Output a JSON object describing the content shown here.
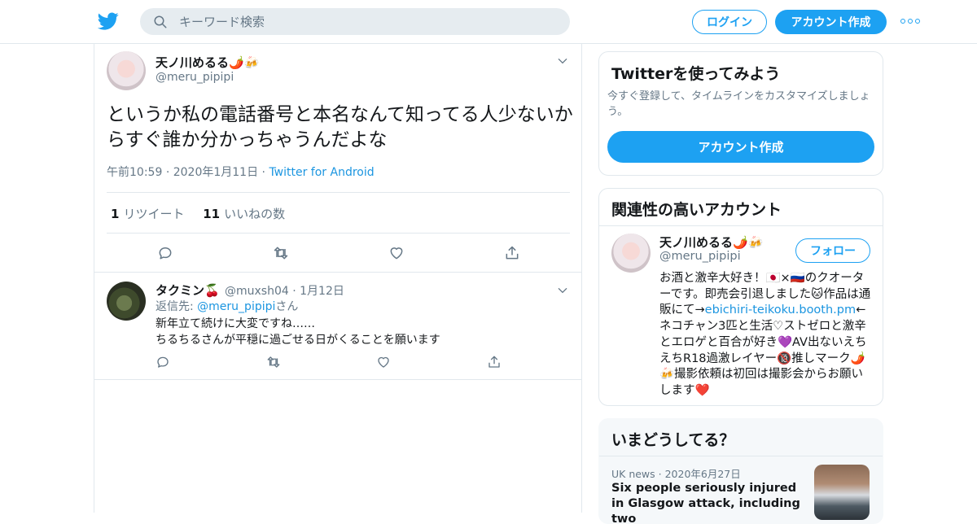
{
  "header": {
    "search_placeholder": "キーワード検索",
    "login_label": "ログイン",
    "signup_label": "アカウント作成"
  },
  "tweet": {
    "display_name": "天ノ川めるる🌶️🍻",
    "handle": "@meru_pipipi",
    "text": "というか私の電話番号と本名なんて知ってる人少ないからすぐ誰か分かっちゃうんだよな",
    "time": "午前10:59",
    "date": "2020年1月11日",
    "source": "Twitter for Android",
    "retweet_count": "1",
    "retweet_label": "リツイート",
    "like_count": "11",
    "like_label": "いいねの数"
  },
  "reply": {
    "display_name": "タクミン🍒",
    "handle": "@muxsh04",
    "date": "1月12日",
    "replying_prefix": "返信先: ",
    "replying_to": "@meru_pipipi",
    "replying_suffix": "さん",
    "line1": "新年立て続けに大変ですね……",
    "line2": "ちるちるさんが平穏に過ごせる日がくることを願います"
  },
  "signup_card": {
    "title": "Twitterを使ってみよう",
    "text": "今すぐ登録して、タイムラインをカスタマイズしましょう。",
    "button": "アカウント作成"
  },
  "related": {
    "title": "関連性の高いアカウント",
    "display_name": "天ノ川めるる🌶️🍻",
    "handle": "@meru_pipipi",
    "follow_label": "フォロー",
    "bio_1": "お酒と激辛大好き！🇯🇵×🇷🇺のクオーターです。即売会引退しました🐱作品は通販にて→",
    "bio_link": "ebichiri-teikoku.booth.pm",
    "bio_2": "←ネコチャン3匹と生活♡ストゼロと激辛とエロゲと百合が好き💜AV出ないえちえちR18過激レイヤー🔞推しマーク🌶️🍻撮影依頼は初回は撮影会からお願いします❤️"
  },
  "trends": {
    "title": "いまどうしてる？",
    "item_category": "UK news",
    "item_date": "2020年6月27日",
    "item_headline": "Six people seriously injured in Glasgow attack, including two"
  },
  "colors": {
    "accent": "#1da1f2",
    "link": "#1b95e0",
    "muted": "#657786",
    "border": "#e1e8ed"
  }
}
